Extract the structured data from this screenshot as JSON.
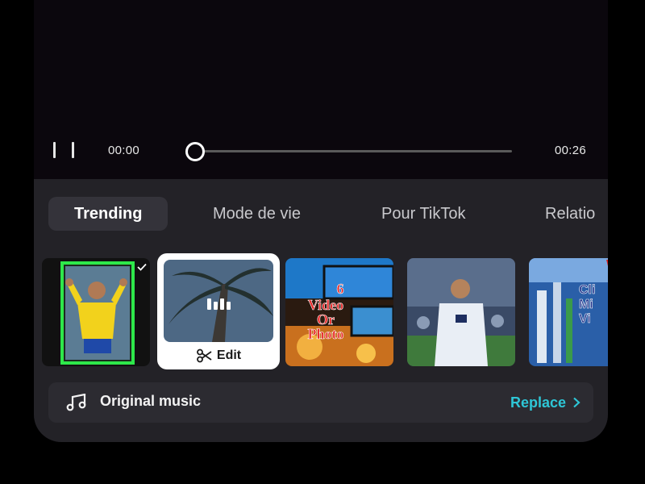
{
  "player": {
    "current_time": "00:00",
    "duration": "00:26",
    "progress_fraction": 0
  },
  "tabs": [
    {
      "label": "Trending",
      "active": true
    },
    {
      "label": "Mode de vie",
      "active": false
    },
    {
      "label": "Pour TikTok",
      "active": false
    },
    {
      "label": "Relatio",
      "active": false
    }
  ],
  "templates": {
    "edit_label": "Edit",
    "items": [
      {
        "name": "template-brazil-player",
        "checked": true
      },
      {
        "name": "template-palm-trees",
        "selected": true
      },
      {
        "name": "template-6-video-or-photo",
        "text": [
          "6",
          "Video",
          "Or",
          "Photo"
        ]
      },
      {
        "name": "template-real-madrid-player"
      },
      {
        "name": "template-city-aerial",
        "text": [
          "Cli",
          "Mi",
          "Vi"
        ]
      }
    ]
  },
  "music": {
    "label": "Original music",
    "replace_label": "Replace"
  },
  "colors": {
    "accent": "#2ec6d6",
    "panel": "#232227",
    "player_bg": "#0b070d"
  }
}
